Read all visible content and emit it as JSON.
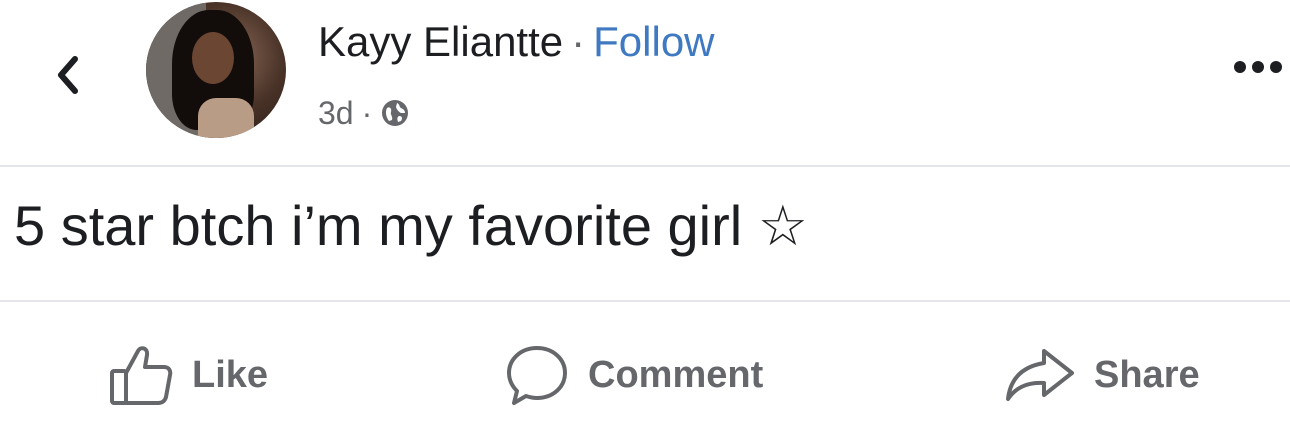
{
  "header": {
    "back_icon": "chevron-left-icon",
    "author_name": "Kayy Eliantte",
    "separator": "·",
    "follow_label": "Follow",
    "time_ago": "3d",
    "meta_separator": "·",
    "privacy_icon": "globe-icon",
    "more_icon": "more-dots-icon"
  },
  "post": {
    "text": "5 star btch i’m my favorite girl ☆"
  },
  "actions": {
    "like_label": "Like",
    "comment_label": "Comment",
    "share_label": "Share"
  },
  "colors": {
    "link": "#3f79c2",
    "muted": "#65676b",
    "text": "#1c1e21",
    "divider": "#e4e6eb"
  }
}
